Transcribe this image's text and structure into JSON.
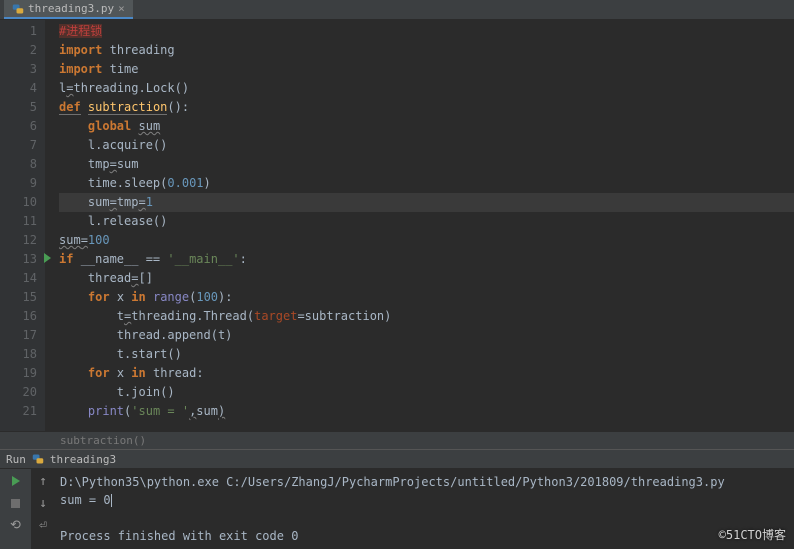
{
  "tab": {
    "filename": "threading3.py",
    "close": "×"
  },
  "gutter": {
    "lines": [
      "1",
      "2",
      "3",
      "4",
      "5",
      "6",
      "7",
      "8",
      "9",
      "10",
      "11",
      "12",
      "13",
      "14",
      "15",
      "16",
      "17",
      "18",
      "19",
      "20",
      "21"
    ],
    "run_marker_line": 13,
    "active_line": 10
  },
  "code": {
    "l1_comment": "#进程锁",
    "l2_import": "import",
    "l2_mod": "threading",
    "l3_import": "import",
    "l3_mod": "time",
    "l4_lhs": "l",
    "l4_eq": "=",
    "l4_rhs": "threading.Lock()",
    "l5_def": "def",
    "l5_name": "subtraction",
    "l5_paren": "():",
    "l6_global": "global",
    "l6_var": "sum",
    "l7": "l.acquire()",
    "l8_lhs": "tmp",
    "l8_eq": "=",
    "l8_rhs": "sum",
    "l9_a": "time.sleep(",
    "l9_num": "0.001",
    "l9_b": ")",
    "l10_a": "sum",
    "l10_eq1": "=",
    "l10_b": "tmp",
    "l10_eq2": "=",
    "l10_c": "1",
    "l11": "l.release()",
    "l12_a": "sum",
    "l12_eq": "=",
    "l12_b": "100",
    "l13_if": "if",
    "l13_name": "__name__",
    "l13_eq": " == ",
    "l13_str": "'__main__'",
    "l13_colon": ":",
    "l14_a": "thread",
    "l14_eq": "=",
    "l14_b": "[]",
    "l15_for": "for",
    "l15_x": "x",
    "l15_in": "in",
    "l15_range": "range",
    "l15_open": "(",
    "l15_num": "100",
    "l15_close": "):",
    "l16_a": "t",
    "l16_eq": "=",
    "l16_b": "threading.Thread(",
    "l16_kw": "target",
    "l16_c": "=subtraction)",
    "l17": "thread.append(t)",
    "l18": "t.start()",
    "l19_for": "for",
    "l19_x": "x",
    "l19_in": "in",
    "l19_thread": "thread",
    "l19_colon": ":",
    "l20": "t.join()",
    "l21_print": "print",
    "l21_open": "(",
    "l21_str": "'sum = '",
    "l21_comma": ",",
    "l21_sum": "sum",
    "l21_close": ")"
  },
  "breadcrumb": "subtraction()",
  "run": {
    "label": "Run",
    "config": "threading3",
    "command": "D:\\Python35\\python.exe C:/Users/ZhangJ/PycharmProjects/untitled/Python3/201809/threading3.py",
    "output_label": "sum = ",
    "output_value": "0",
    "exit": "Process finished with exit code 0"
  },
  "watermark": "©51CTO博客"
}
